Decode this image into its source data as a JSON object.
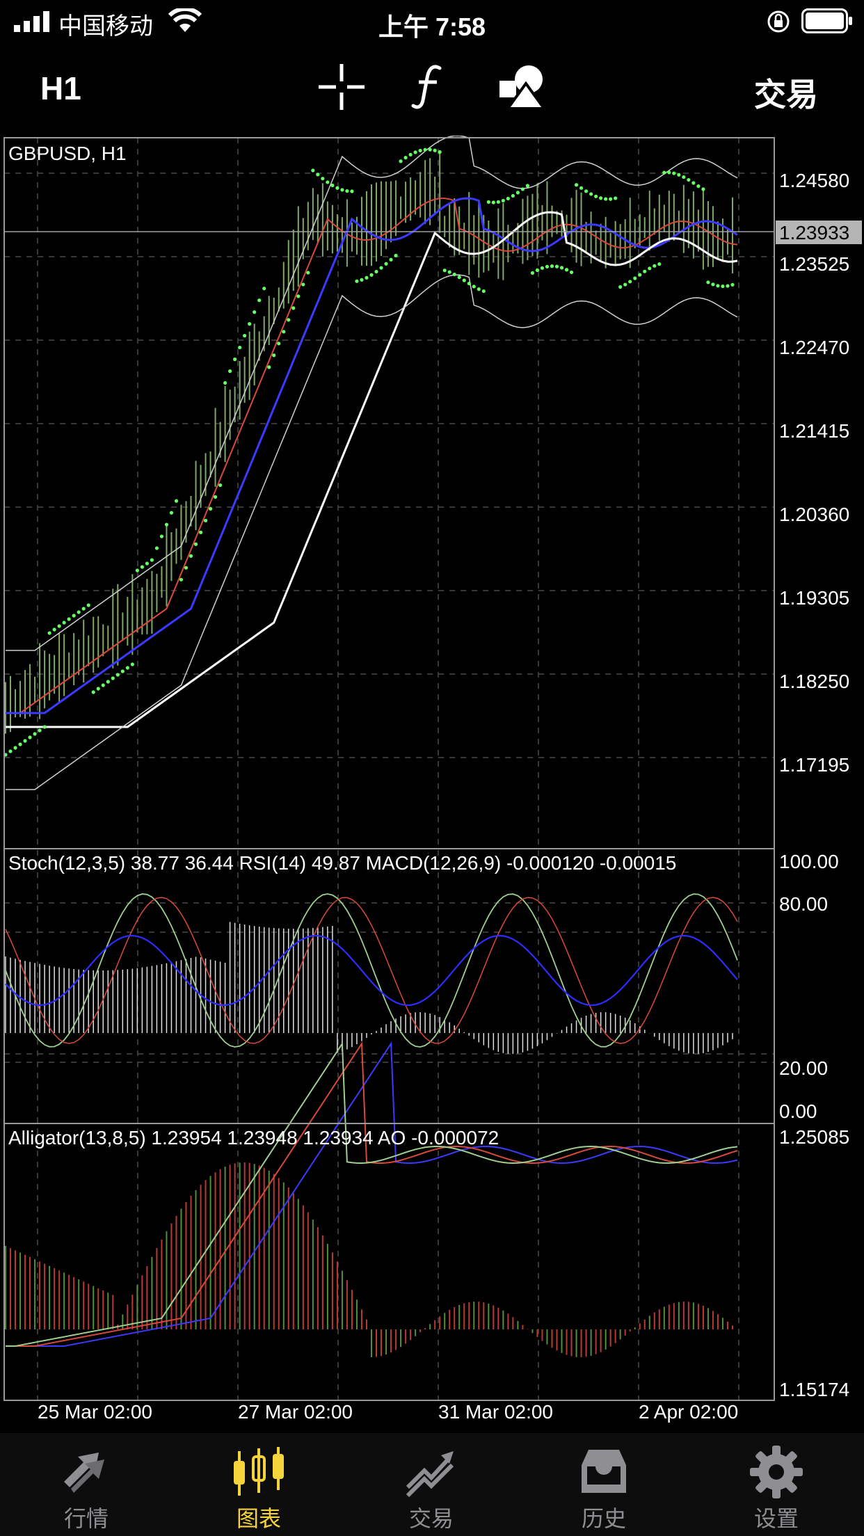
{
  "status_bar": {
    "carrier": "中国移动",
    "time": "上午 7:58",
    "icons": [
      "signal-icon",
      "wifi-icon",
      "rotation-lock-icon",
      "battery-icon"
    ]
  },
  "toolbar": {
    "period": "H1",
    "trade": "交易",
    "icons": [
      "crosshair-icon",
      "function-icon",
      "shapes-icon"
    ]
  },
  "chart": {
    "symbol_label": "GBPUSD, H1",
    "current_price": "1.23933",
    "price_levels": [
      "1.24580",
      "1.23525",
      "1.22470",
      "1.21415",
      "1.20360",
      "1.19305",
      "1.18250",
      "1.17195"
    ],
    "x_labels": [
      "25 Mar 02:00",
      "27 Mar 02:00",
      "31 Mar 02:00",
      "2 Apr 02:00"
    ],
    "colors": {
      "background": "#000000",
      "grid": "#4a4a4a",
      "candle": "#7fa86b",
      "bullish_bar": "#4f8f3e",
      "bearish_bar": "#b73a36",
      "psar": "#66ff66",
      "ma_fast": "#d94a3a",
      "ma_mid": "#3b3bff",
      "ma_slow": "#ffffff"
    }
  },
  "oscillator": {
    "label": "Stoch(12,3,5) 38.77 36.44 RSI(14) 49.87 MACD(12,26,9) -0.000120 -0.00015",
    "levels": [
      "100.00",
      "80.00",
      "20.00",
      "0.00"
    ]
  },
  "alligator": {
    "label": "Alligator(13,8,5) 1.23954 1.23948 1.23934 AO -0.000072",
    "levels": [
      "1.25085",
      "1.15174"
    ]
  },
  "tabs": [
    {
      "label": "行情",
      "icon": "quotes-icon",
      "active": false
    },
    {
      "label": "图表",
      "icon": "chart-icon",
      "active": true
    },
    {
      "label": "交易",
      "icon": "trade-icon",
      "active": false
    },
    {
      "label": "历史",
      "icon": "history-icon",
      "active": false
    },
    {
      "label": "设置",
      "icon": "settings-icon",
      "active": false
    }
  ]
}
